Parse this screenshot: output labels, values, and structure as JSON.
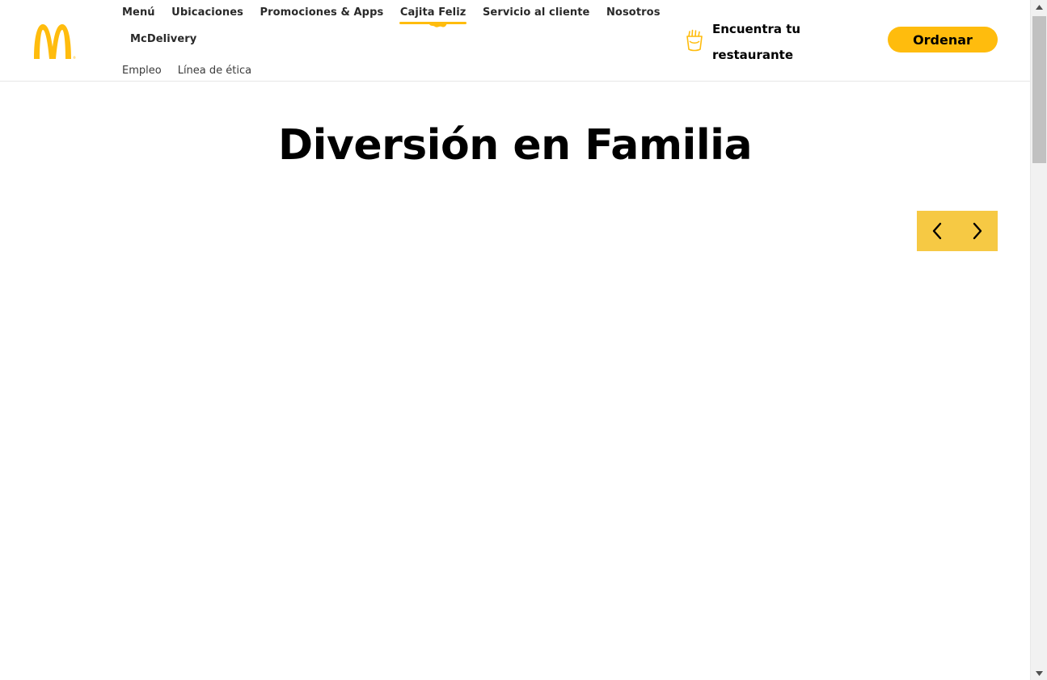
{
  "brand": {
    "logo_icon": "golden-arches-icon",
    "accent_color": "#ffbc0d"
  },
  "nav": {
    "primary": [
      {
        "label": "Menú"
      },
      {
        "label": "Ubicaciones"
      },
      {
        "label": "Promociones & Apps"
      },
      {
        "label": "Cajita Feliz",
        "active": true
      },
      {
        "label": "Servicio al cliente"
      },
      {
        "label": "Nosotros"
      }
    ],
    "primary_row2": [
      {
        "label": "McDelivery"
      }
    ],
    "secondary": [
      {
        "label": "Empleo"
      },
      {
        "label": "Línea de ética"
      }
    ]
  },
  "find_restaurant": {
    "label": "Encuentra tu restaurante",
    "icon": "fries-icon"
  },
  "order_button": {
    "label": "Ordenar"
  },
  "main": {
    "title": "Diversión en Familia",
    "carousel": {
      "prev_icon": "chevron-left-icon",
      "next_icon": "chevron-right-icon",
      "controls_color": "#f6c944"
    }
  }
}
